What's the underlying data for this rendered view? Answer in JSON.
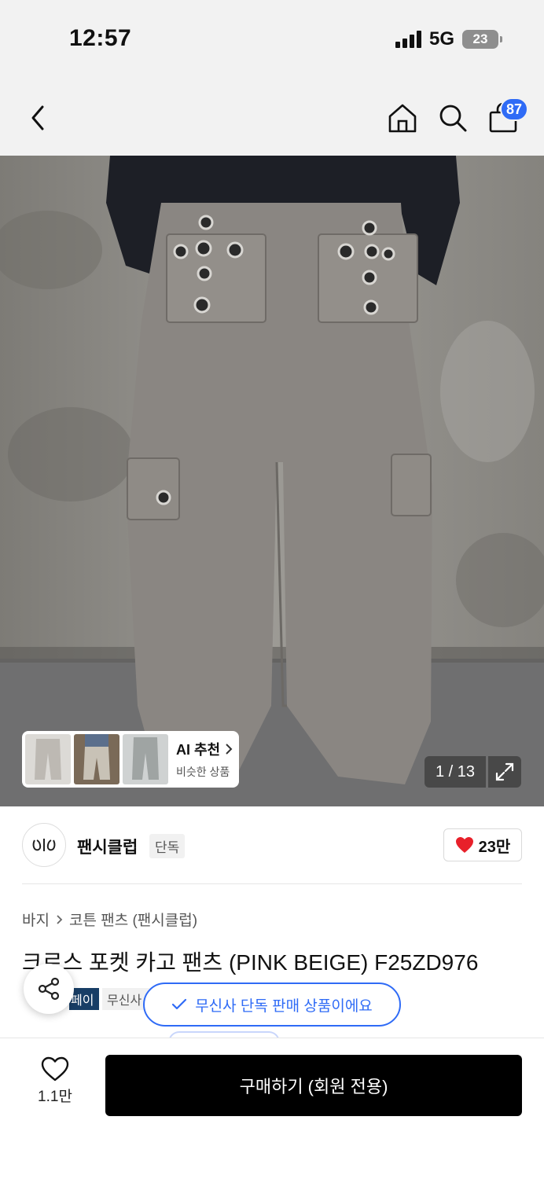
{
  "status_bar": {
    "time": "12:57",
    "network": "5G",
    "battery": "23"
  },
  "nav": {
    "back_icon": "chevron-left-icon",
    "home_icon": "home-icon",
    "search_icon": "search-icon",
    "cart_icon": "shopping-bag-icon",
    "cart_count": "87",
    "badge_color": "#2f6bf6"
  },
  "gallery": {
    "ai_title": "AI 추천",
    "ai_subtitle": "비슷한 상품",
    "page_counter": "1 / 13",
    "expand_icon": "expand-icon"
  },
  "brand": {
    "name": "팬시클럽",
    "tag": "단독",
    "likes": "23만"
  },
  "breadcrumb": {
    "category": "바지",
    "sub_category": "코튼 팬츠 (팬시클럽)"
  },
  "product": {
    "title": "크로스 포켓 카고 팬츠 (PINK BEIGE) F25ZD976",
    "tag_pay": "페이",
    "tag_musinsa": "무신사"
  },
  "toast": {
    "message": "무신사 단독 판매 상품이에요"
  },
  "bottom": {
    "wish_count": "1.1만",
    "buy_label": "구매하기 (회원 전용)"
  }
}
